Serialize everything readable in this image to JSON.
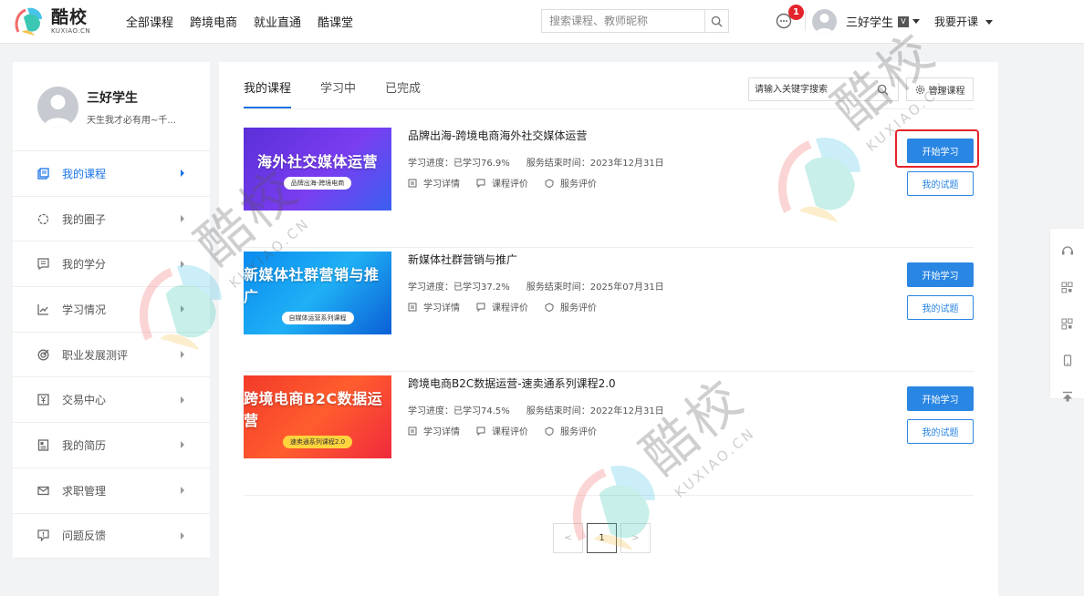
{
  "header": {
    "logo_cn": "酷校",
    "logo_en": "KUXIAO.CN",
    "nav": [
      "全部课程",
      "跨境电商",
      "就业直通",
      "酷课堂"
    ],
    "search_placeholder": "搜索课程、教师昵称",
    "message_count": "1",
    "username": "三好学生",
    "vip_badge": "V",
    "teach_label": "我要开课"
  },
  "sidebar": {
    "name": "三好学生",
    "signature": "天生我才必有用~千...",
    "items": [
      {
        "label": "我的课程",
        "icon": "book-icon",
        "active": true
      },
      {
        "label": "我的圈子",
        "icon": "circle-icon",
        "active": false
      },
      {
        "label": "我的学分",
        "icon": "credit-icon",
        "active": false
      },
      {
        "label": "学习情况",
        "icon": "chart-icon",
        "active": false
      },
      {
        "label": "职业发展测评",
        "icon": "target-icon",
        "active": false
      },
      {
        "label": "交易中心",
        "icon": "yen-icon",
        "active": false
      },
      {
        "label": "我的简历",
        "icon": "resume-icon",
        "active": false
      },
      {
        "label": "求职管理",
        "icon": "mail-icon",
        "active": false
      },
      {
        "label": "问题反馈",
        "icon": "feedback-icon",
        "active": false
      }
    ]
  },
  "main": {
    "tabs": [
      "我的课程",
      "学习中",
      "已完成"
    ],
    "keyword_placeholder": "请输入关键字搜索",
    "manage_label": "管理课程",
    "courses": [
      {
        "title": "品牌出海-跨境电商海外社交媒体运营",
        "thumb_title": "海外社交媒体运营",
        "thumb_sub": "品牌出海-跨境电商",
        "progress": "学习进度：已学习76.9%",
        "end_date": "服务结束时间：2023年12月31日",
        "link_detail": "学习详情",
        "link_course_eval": "课程评价",
        "link_service_eval": "服务评价",
        "start_label": "开始学习",
        "quiz_label": "我的试题"
      },
      {
        "title": "新媒体社群营销与推广",
        "thumb_title": "新媒体社群营销与推广",
        "thumb_sub": "自媒体运营系列课程",
        "progress": "学习进度：已学习37.2%",
        "end_date": "服务结束时间：2025年07月31日",
        "link_detail": "学习详情",
        "link_course_eval": "课程评价",
        "link_service_eval": "服务评价",
        "start_label": "开始学习",
        "quiz_label": "我的试题"
      },
      {
        "title": "跨境电商B2C数据运营-速卖通系列课程2.0",
        "thumb_title": "跨境电商B2C数据运营",
        "thumb_sub": "速卖通系列课程2.0",
        "progress": "学习进度：已学习74.5%",
        "end_date": "服务结束时间：2022年12月31日",
        "link_detail": "学习详情",
        "link_course_eval": "课程评价",
        "link_service_eval": "服务评价",
        "start_label": "开始学习",
        "quiz_label": "我的试题"
      }
    ],
    "pagination": {
      "prev": "<",
      "current": "1",
      "next": ">"
    }
  },
  "watermark": {
    "cn": "酷校",
    "en": "KUXIAO.CN"
  },
  "colors": {
    "accent": "#2a86e3",
    "highlight": "#e4242b"
  }
}
